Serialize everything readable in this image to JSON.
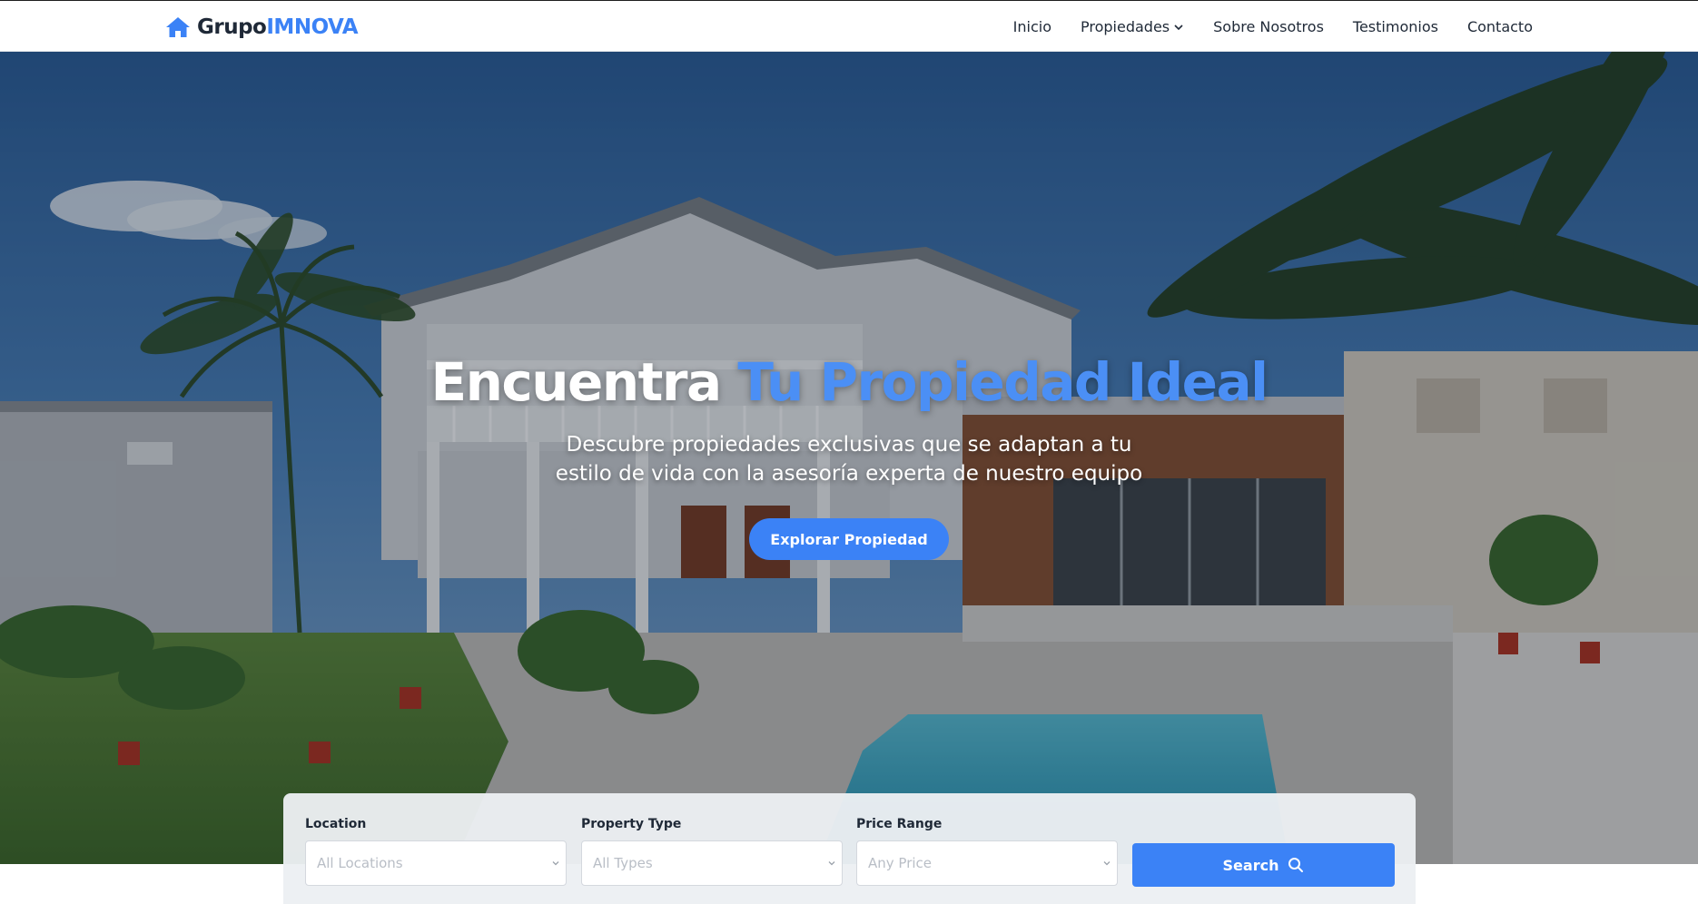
{
  "brand": {
    "part1": "Grupo",
    "part2": "IMNOVA",
    "icon": "home-icon"
  },
  "nav": {
    "items": [
      {
        "label": "Inicio"
      },
      {
        "label": "Propiedades",
        "icon": "chevron-down-icon"
      },
      {
        "label": "Sobre Nosotros"
      },
      {
        "label": "Testimonios"
      },
      {
        "label": "Contacto"
      }
    ]
  },
  "hero": {
    "title_part1": "Encuentra",
    "title_part2": "Tu Propiedad Ideal",
    "subtitle_line1": "Descubre propiedades exclusivas que se adaptan a tu",
    "subtitle_line2": "estilo de vida con la asesoría experta de nuestro equipo",
    "cta_label": "Explorar Propiedad"
  },
  "search": {
    "location": {
      "label": "Location",
      "value": "All Locations"
    },
    "property_type": {
      "label": "Property Type",
      "value": "All Types"
    },
    "price_range": {
      "label": "Price Range",
      "value": "Any Price"
    },
    "button_label": "Search",
    "button_icon": "search-icon"
  },
  "colors": {
    "accent": "#3b82f6",
    "brand_accent": "#3b82f6",
    "text_dark": "#1f2937"
  }
}
